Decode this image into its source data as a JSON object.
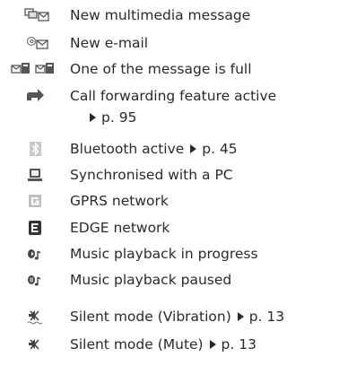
{
  "rows": [
    {
      "icon": "multimedia-message-icon",
      "label": "New multimedia message"
    },
    {
      "icon": "email-icon",
      "label": "New e-mail"
    },
    {
      "icon": "message-full-icon",
      "label": "One of the message is full"
    },
    {
      "icon": "call-forwarding-icon",
      "label": "Call forwarding feature active",
      "ref": "p. 95"
    },
    {
      "icon": "bluetooth-icon",
      "label": "Bluetooth active",
      "ref": "p. 45"
    },
    {
      "icon": "pc-sync-icon",
      "label": "Synchronised with a PC"
    },
    {
      "icon": "gprs-icon",
      "label": "GPRS network"
    },
    {
      "icon": "edge-icon",
      "label": "EDGE network"
    },
    {
      "icon": "music-playing-icon",
      "label": "Music playback in progress"
    },
    {
      "icon": "music-paused-icon",
      "label": "Music playback paused"
    },
    {
      "icon": "silent-vibration-icon",
      "label": "Silent mode (Vibration)",
      "ref": "p. 13"
    },
    {
      "icon": "silent-mute-icon",
      "label": "Silent mode (Mute)",
      "ref": "p. 13"
    }
  ]
}
